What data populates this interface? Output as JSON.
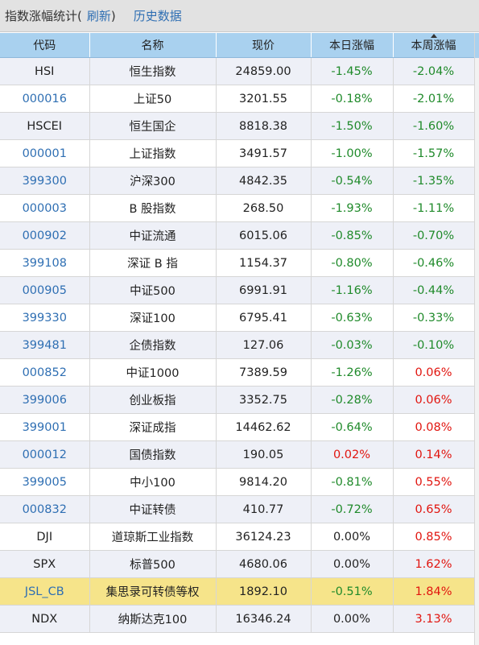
{
  "toolbar": {
    "title": "指数涨幅统计(",
    "refresh_label": "刷新",
    "close_paren": " )",
    "history_label": "历史数据"
  },
  "table": {
    "headers": [
      "代码",
      "名称",
      "现价",
      "本日涨幅",
      "本周涨幅"
    ],
    "sorted_column": "本周涨幅",
    "rows": [
      {
        "code": "HSI",
        "name": "恒生指数",
        "price": "24859.00",
        "day": "-1.45%",
        "week": "-2.04%"
      },
      {
        "code": "000016",
        "name": "上证50",
        "price": "3201.55",
        "day": "-0.18%",
        "week": "-2.01%"
      },
      {
        "code": "HSCEI",
        "name": "恒生国企",
        "price": "8818.38",
        "day": "-1.50%",
        "week": "-1.60%"
      },
      {
        "code": "000001",
        "name": "上证指数",
        "price": "3491.57",
        "day": "-1.00%",
        "week": "-1.57%"
      },
      {
        "code": "399300",
        "name": "沪深300",
        "price": "4842.35",
        "day": "-0.54%",
        "week": "-1.35%"
      },
      {
        "code": "000003",
        "name": "B 股指数",
        "price": "268.50",
        "day": "-1.93%",
        "week": "-1.11%"
      },
      {
        "code": "000902",
        "name": "中证流通",
        "price": "6015.06",
        "day": "-0.85%",
        "week": "-0.70%"
      },
      {
        "code": "399108",
        "name": "深证 B 指",
        "price": "1154.37",
        "day": "-0.80%",
        "week": "-0.46%"
      },
      {
        "code": "000905",
        "name": "中证500",
        "price": "6991.91",
        "day": "-1.16%",
        "week": "-0.44%"
      },
      {
        "code": "399330",
        "name": "深证100",
        "price": "6795.41",
        "day": "-0.63%",
        "week": "-0.33%"
      },
      {
        "code": "399481",
        "name": "企债指数",
        "price": "127.06",
        "day": "-0.03%",
        "week": "-0.10%"
      },
      {
        "code": "000852",
        "name": "中证1000",
        "price": "7389.59",
        "day": "-1.26%",
        "week": "0.06%"
      },
      {
        "code": "399006",
        "name": "创业板指",
        "price": "3352.75",
        "day": "-0.28%",
        "week": "0.06%"
      },
      {
        "code": "399001",
        "name": "深证成指",
        "price": "14462.62",
        "day": "-0.64%",
        "week": "0.08%"
      },
      {
        "code": "000012",
        "name": "国债指数",
        "price": "190.05",
        "day": "0.02%",
        "week": "0.14%"
      },
      {
        "code": "399005",
        "name": "中小100",
        "price": "9814.20",
        "day": "-0.81%",
        "week": "0.55%"
      },
      {
        "code": "000832",
        "name": "中证转债",
        "price": "410.77",
        "day": "-0.72%",
        "week": "0.65%"
      },
      {
        "code": "DJI",
        "name": "道琼斯工业指数",
        "price": "36124.23",
        "day": "0.00%",
        "week": "0.85%"
      },
      {
        "code": "SPX",
        "name": "标普500",
        "price": "4680.06",
        "day": "0.00%",
        "week": "1.62%"
      },
      {
        "code": "JSL_CB",
        "name": "集思录可转债等权",
        "price": "1892.10",
        "day": "-0.51%",
        "week": "1.84%"
      },
      {
        "code": "NDX",
        "name": "纳斯达克100",
        "price": "16346.24",
        "day": "0.00%",
        "week": "3.13%"
      }
    ],
    "highlighted_code": "JSL_CB",
    "plain_codes": [
      "HSI",
      "HSCEI",
      "DJI",
      "SPX",
      "NDX"
    ],
    "link_codes": [
      "000016",
      "000001",
      "399300",
      "000003",
      "000902",
      "399108",
      "000905",
      "399330",
      "399481",
      "000852",
      "399006",
      "399001",
      "000012",
      "399005",
      "000832",
      "JSL_CB"
    ]
  },
  "colors": {
    "header_bg": "#a9d1ef",
    "alt_row_bg": "#eef0f7",
    "highlight_row_bg": "#f6e48a",
    "link": "#2f6fb3",
    "negative": "#1f8a2a",
    "positive": "#e1150f"
  },
  "icons": {
    "sort_indicator": "sort-asc-icon"
  }
}
